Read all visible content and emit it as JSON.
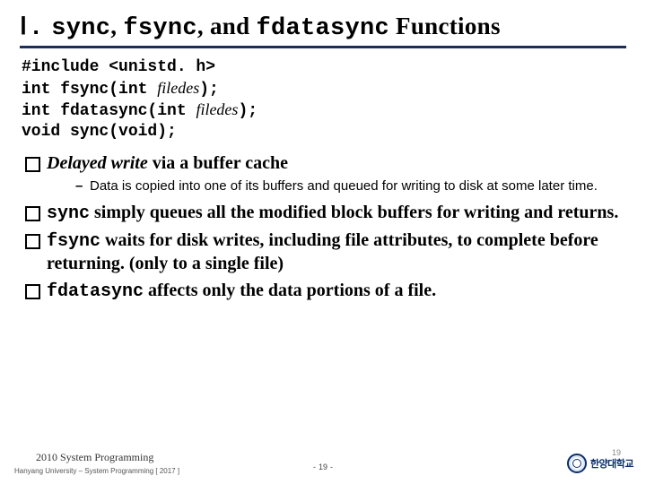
{
  "title": {
    "roman": "Ⅰ.",
    "m1": "sync",
    "c1": ", ",
    "m2": "fsync",
    "c2": ", and ",
    "m3": "fdatasync",
    "tail": " Functions"
  },
  "code": {
    "l1a": "#include <unistd. h>",
    "l2a": "int fsync(int ",
    "l2arg": "filedes",
    "l2b": ");",
    "l3a": "int fdatasync(int ",
    "l3arg": "filedes",
    "l3b": ");",
    "l4a": "void sync(void);"
  },
  "bullets": {
    "b1_ital": "Delayed write",
    "b1_rest": " via a buffer cache",
    "b1_sub": "Data is copied into one of its buffers and queued for writing to disk at some later time.",
    "b2_mono": "sync",
    "b2_rest": " simply queues all the modified block buffers for writing and returns.",
    "b3_mono": "fsync",
    "b3_rest": " waits for disk writes, including file attributes, to complete before returning. (only to a single file)",
    "b4_mono": "fdatasync",
    "b4_rest": " affects only the data portions of a file."
  },
  "footer": {
    "course": "2010 System Programming",
    "dept": "Hanyang University – System Programming  [ 2017 ]",
    "page": "19",
    "page_dup": "19",
    "university": "한양대학교"
  }
}
